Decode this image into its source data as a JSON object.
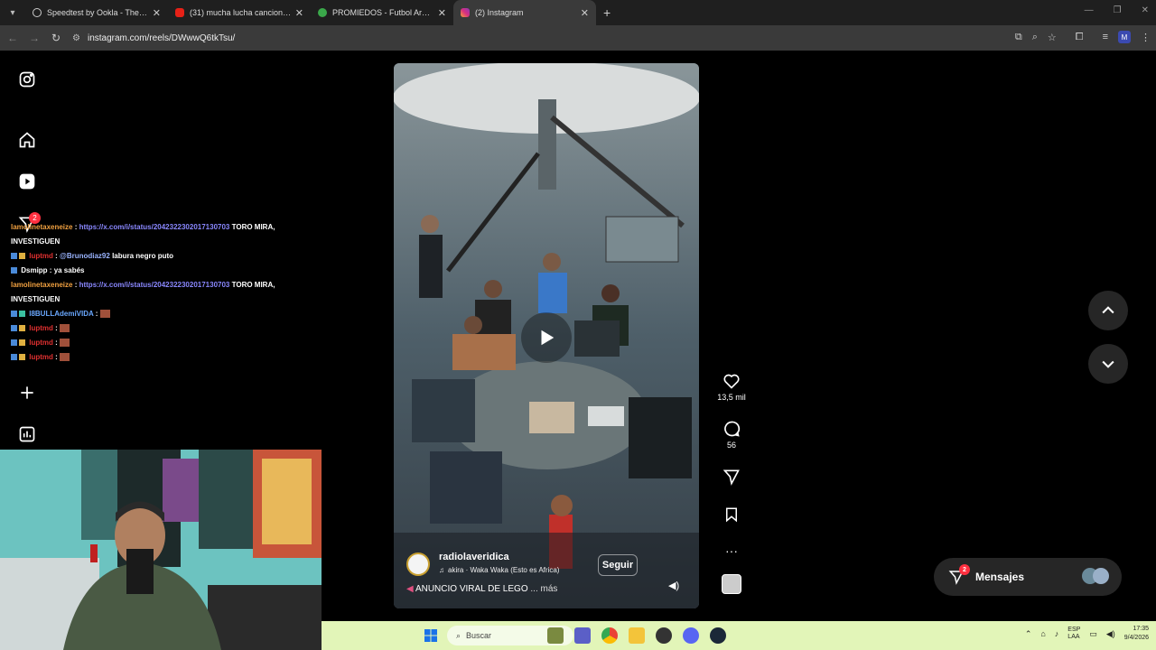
{
  "browser": {
    "tabs": [
      {
        "title": "Speedtest by Ookla - The Glob",
        "active": false
      },
      {
        "title": "(31) mucha lucha cancion - You",
        "active": false
      },
      {
        "title": "PROMIEDOS - Futbol Argentin",
        "active": false
      },
      {
        "title": "(2) Instagram",
        "active": true
      }
    ],
    "url": "instagram.com/reels/DWwwQ6tkTsu/"
  },
  "instagram": {
    "notification_count": "2",
    "likes": "13,5 mil",
    "comments": "56",
    "author": "radiolaveridica",
    "audio": "akira · Waka Waka (Esto es Africa)",
    "follow_label": "Seguir",
    "caption": "ANUNCIO VIRAL DE LEGO",
    "more_label": "... más",
    "messages_label": "Mensajes",
    "messages_count": "2"
  },
  "chat": [
    {
      "user": "lamolinetaxeneize",
      "user_color": "#f0a040",
      "link": "https://x.com/i/status/2042322302017130703",
      "text": "TORO MIRA, INVESTIGUEN"
    },
    {
      "user": "luptmd",
      "user_color": "#e03030",
      "mention": "@Brunodiaz92",
      "text": "labura negro puto"
    },
    {
      "user": "Dsmipp",
      "user_color": "#ffffff",
      "text": "ya sabés"
    },
    {
      "user": "lamolinetaxeneize",
      "user_color": "#f0a040",
      "link": "https://x.com/i/status/2042322302017130703",
      "text": "TORO MIRA, INVESTIGUEN"
    },
    {
      "user": "l8BULLAdemiVIDA",
      "user_color": "#6aa8ff",
      "text": ""
    },
    {
      "user": "luptmd",
      "user_color": "#e03030",
      "text": ""
    },
    {
      "user": "luptmd",
      "user_color": "#e03030",
      "text": ""
    },
    {
      "user": "luptmd",
      "user_color": "#e03030",
      "text": ""
    }
  ],
  "taskbar": {
    "search_placeholder": "Buscar",
    "lang_top": "ESP",
    "lang_bottom": "LAA",
    "time": "17:35",
    "date": "9/4/2026"
  }
}
